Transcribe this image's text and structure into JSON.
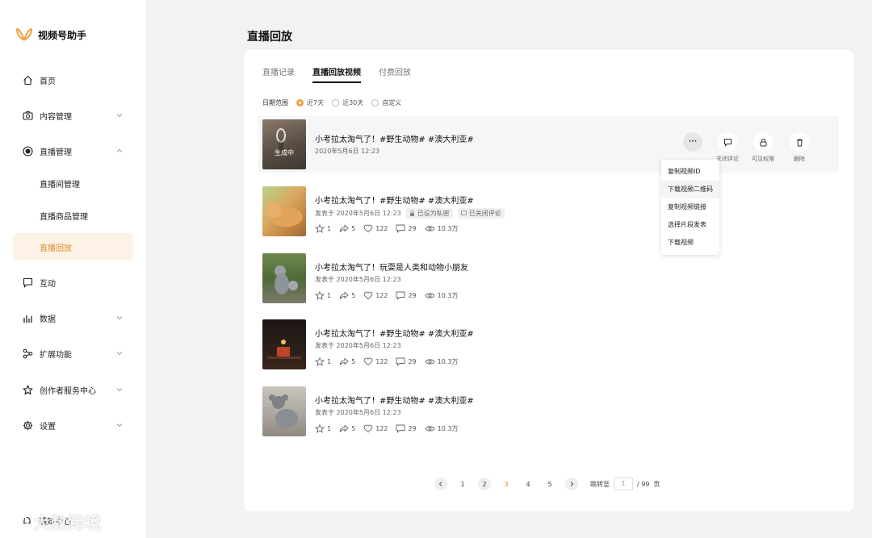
{
  "app": {
    "name": "视频号助手",
    "brand_color": "#f0a040"
  },
  "sidebar": {
    "items": [
      {
        "label": "首页",
        "icon": "home-icon"
      },
      {
        "label": "内容管理",
        "icon": "camera-icon",
        "expandable": true
      },
      {
        "label": "直播管理",
        "icon": "live-icon",
        "expandable": true,
        "expanded": true
      },
      {
        "label": "互动",
        "icon": "message-icon"
      },
      {
        "label": "数据",
        "icon": "bar-chart-icon",
        "expandable": true
      },
      {
        "label": "扩展功能",
        "icon": "extension-icon",
        "expandable": true
      },
      {
        "label": "创作者服务中心",
        "icon": "star-icon",
        "expandable": true
      },
      {
        "label": "设置",
        "icon": "gear-icon",
        "expandable": true
      }
    ],
    "live_sub_items": [
      {
        "label": "直播间管理"
      },
      {
        "label": "直播商品管理"
      },
      {
        "label": "直播回放",
        "active": true
      }
    ],
    "notification": "通知中心",
    "watermark": "大数跨境"
  },
  "page": {
    "title": "直播回放"
  },
  "tabs": [
    {
      "label": "直播记录",
      "active": false
    },
    {
      "label": "直播回放视频",
      "active": true
    },
    {
      "label": "付费回放",
      "active": false
    }
  ],
  "filter": {
    "label": "日期范围",
    "options": [
      {
        "label": "近7天",
        "selected": true
      },
      {
        "label": "近30天",
        "selected": false
      },
      {
        "label": "自定义",
        "selected": false
      }
    ]
  },
  "videos": [
    {
      "title": "小考拉太淘气了！#野生动物# #澳大利亚#",
      "date": "2020年5月6日 12:23",
      "status": "生成中"
    },
    {
      "title": "小考拉太淘气了！#野生动物# #澳大利亚#",
      "date": "发表于 2020年5月6日 12:23",
      "tags": [
        "已设为私密",
        "已关闭评论"
      ],
      "stats": {
        "favorites": "1",
        "shares": "5",
        "likes": "122",
        "comments": "29",
        "views": "10.3万"
      }
    },
    {
      "title": "小考拉太淘气了！玩耍是人类和动物小朋友",
      "date": "发表于 2020年5月6日 12:23",
      "stats": {
        "favorites": "1",
        "shares": "5",
        "likes": "122",
        "comments": "29",
        "views": "10.3万"
      }
    },
    {
      "title": "小考拉太淘气了！#野生动物# #澳大利亚#",
      "date": "发表于 2020年5月6日 12:23",
      "stats": {
        "favorites": "1",
        "shares": "5",
        "likes": "122",
        "comments": "29",
        "views": "10.3万"
      }
    },
    {
      "title": "小考拉太淘气了！#野生动物# #澳大利亚#",
      "date": "发表于 2020年5月6日 12:23",
      "stats": {
        "favorites": "1",
        "shares": "5",
        "likes": "122",
        "comments": "29",
        "views": "10.3万"
      }
    }
  ],
  "row_actions": {
    "more": "···",
    "comment": "关闭评论",
    "visibility": "可见权限",
    "delete": "删除"
  },
  "more_menu": [
    "复制视频ID",
    "下载视频二维码",
    "复制视频链接",
    "选择片段发表",
    "下载视频"
  ],
  "pagination": {
    "pages": [
      "1",
      "2",
      "3",
      "4",
      "5"
    ],
    "current": "3",
    "jump_label": "跳转至",
    "jump_value": "1",
    "total": "/ 99",
    "page_unit": "页"
  }
}
